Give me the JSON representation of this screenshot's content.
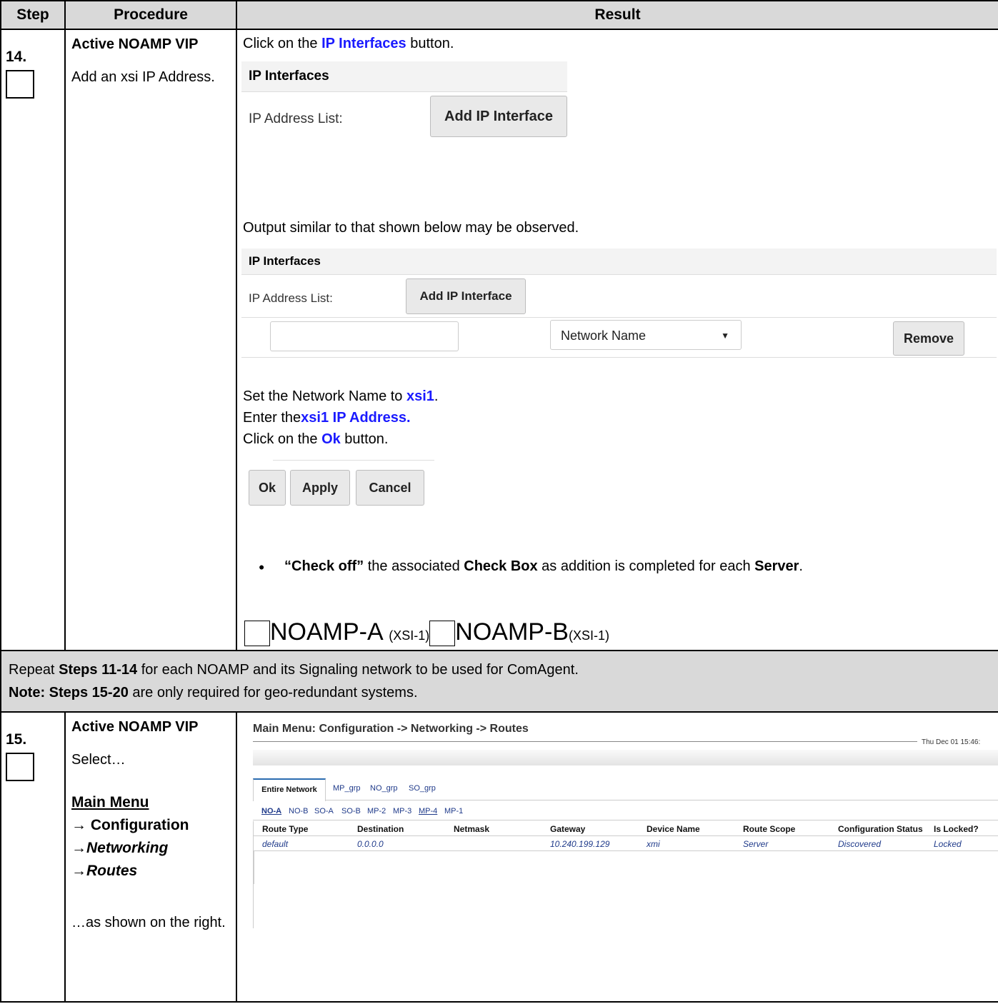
{
  "header": {
    "step": "Step",
    "procedure": "Procedure",
    "result": "Result"
  },
  "step14": {
    "number": "14.",
    "proc_title": "Active NOAMP VIP",
    "proc_desc": "Add an xsi IP Address.",
    "line1_pre": "Click on the ",
    "line1_link": "IP Interfaces",
    "line1_post": " button.",
    "shot1": {
      "title": "IP Interfaces",
      "label": "IP Address List:",
      "button": "Add IP Interface"
    },
    "output_note": "Output similar to that shown below may be observed.",
    "shot2": {
      "title": "IP Interfaces",
      "label": "IP Address List:",
      "button": "Add IP Interface",
      "select_value": "Network Name",
      "remove": "Remove"
    },
    "set_pre": "Set the Network Name to ",
    "set_link": "xsi1",
    "set_post": ".",
    "enter_pre": "Enter the",
    "enter_link": "xsi1  IP Address.",
    "ok_pre": "Click on the ",
    "ok_link": "Ok",
    "ok_post": " button.",
    "shot3": {
      "ok": "Ok",
      "apply": "Apply",
      "cancel": "Cancel"
    },
    "bullet_bold1": "“Check off”",
    "bullet_mid": " the associated ",
    "bullet_bold2": "Check Box",
    "bullet_mid2": " as addition is completed for each ",
    "bullet_bold3": "Server",
    "bullet_end": ".",
    "cb1_label": "NOAMP-A",
    "cb1_sub": "(XSI-1)",
    "cb2_label": "NOAMP-B",
    "cb2_sub": "(XSI-1)"
  },
  "repeat": {
    "line1_pre": "Repeat ",
    "line1_bold": "Steps 11-14",
    "line1_post": " for each NOAMP and its Signaling network to be used for ComAgent.",
    "line2_bold": "Note: Steps 15-20",
    "line2_post": " are only required for geo-redundant systems."
  },
  "step15": {
    "number": "15.",
    "proc_title": "Active NOAMP VIP",
    "select": "Select…",
    "menu_main": "Main Menu",
    "menu_config": "→ Configuration",
    "menu_net": "→Networking",
    "menu_routes": "→Routes",
    "as_shown": "…as shown on the right.",
    "shot": {
      "title": "Main Menu: Configuration -> Networking -> Routes",
      "timestamp": "Thu Dec 01 15:46:",
      "tabs": [
        "Entire Network",
        "MP_grp",
        "NO_grp",
        "SO_grp"
      ],
      "subtabs": [
        "NO-A",
        "NO-B",
        "SO-A",
        "SO-B",
        "MP-2",
        "MP-3",
        "MP-4",
        "MP-1"
      ],
      "columns": [
        "Route Type",
        "Destination",
        "Netmask",
        "Gateway",
        "Device Name",
        "Route Scope",
        "Configuration Status",
        "Is Locked?"
      ],
      "row": [
        "default",
        "0.0.0.0",
        "",
        "10.240.199.129",
        "xmi",
        "Server",
        "Discovered",
        "Locked"
      ]
    }
  },
  "colors": {
    "header_bg": "#d9d9d9",
    "link_blue": "#1a1aff",
    "tab_blue": "#1f3a8a"
  }
}
